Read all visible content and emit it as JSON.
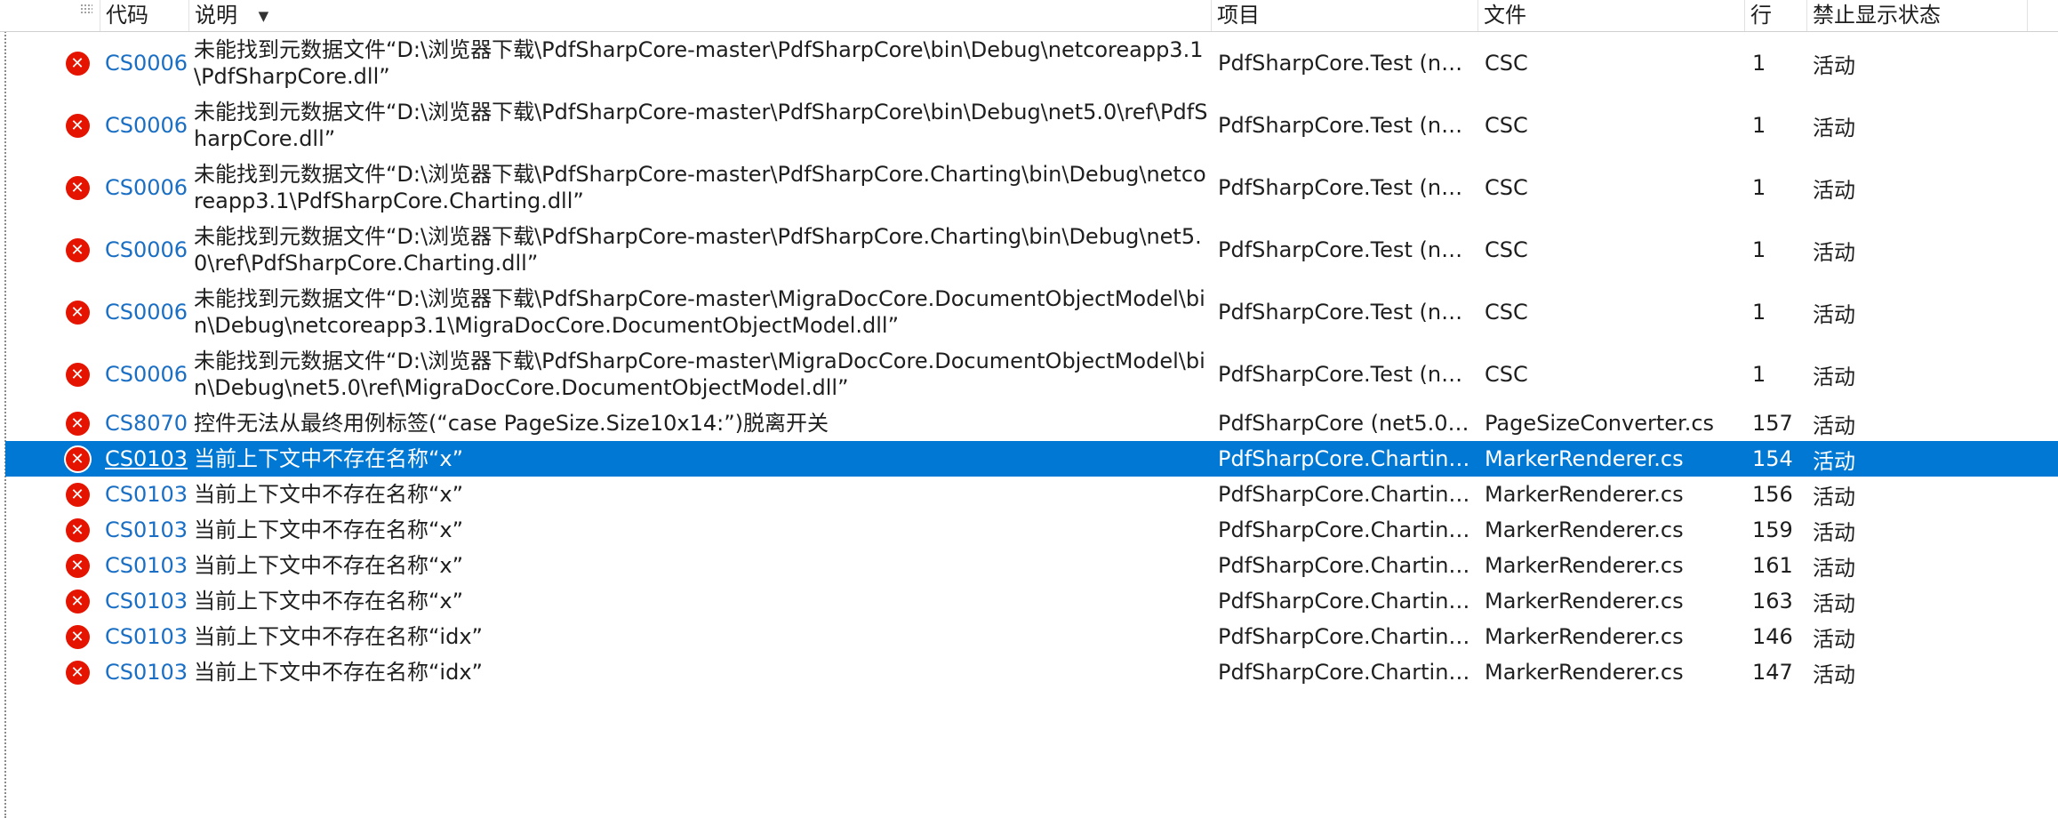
{
  "header": {
    "code": "代码",
    "desc": "说明",
    "project": "项目",
    "file": "文件",
    "line": "行",
    "suppression": "禁止显示状态"
  },
  "rows": [
    {
      "code": "CS0006",
      "desc": "未能找到元数据文件“D:\\浏览器下载\\PdfSharpCore-master\\PdfSharpCore\\bin\\Debug\\netcoreapp3.1\\PdfSharpCore.dll”",
      "project": "PdfSharpCore.Test (net...",
      "file": "CSC",
      "line": "1",
      "state": "活动"
    },
    {
      "code": "CS0006",
      "desc": "未能找到元数据文件“D:\\浏览器下载\\PdfSharpCore-master\\PdfSharpCore\\bin\\Debug\\net5.0\\ref\\PdfSharpCore.dll”",
      "project": "PdfSharpCore.Test (net...",
      "file": "CSC",
      "line": "1",
      "state": "活动"
    },
    {
      "code": "CS0006",
      "desc": "未能找到元数据文件“D:\\浏览器下载\\PdfSharpCore-master\\PdfSharpCore.Charting\\bin\\Debug\\netcoreapp3.1\\PdfSharpCore.Charting.dll”",
      "project": "PdfSharpCore.Test (net...",
      "file": "CSC",
      "line": "1",
      "state": "活动"
    },
    {
      "code": "CS0006",
      "desc": "未能找到元数据文件“D:\\浏览器下载\\PdfSharpCore-master\\PdfSharpCore.Charting\\bin\\Debug\\net5.0\\ref\\PdfSharpCore.Charting.dll”",
      "project": "PdfSharpCore.Test (net...",
      "file": "CSC",
      "line": "1",
      "state": "活动"
    },
    {
      "code": "CS0006",
      "desc": "未能找到元数据文件“D:\\浏览器下载\\PdfSharpCore-master\\MigraDocCore.DocumentObjectModel\\bin\\Debug\\netcoreapp3.1\\MigraDocCore.DocumentObjectModel.dll”",
      "project": "PdfSharpCore.Test (net...",
      "file": "CSC",
      "line": "1",
      "state": "活动"
    },
    {
      "code": "CS0006",
      "desc": "未能找到元数据文件“D:\\浏览器下载\\PdfSharpCore-master\\MigraDocCore.DocumentObjectModel\\bin\\Debug\\net5.0\\ref\\MigraDocCore.DocumentObjectModel.dll”",
      "project": "PdfSharpCore.Test (net...",
      "file": "CSC",
      "line": "1",
      "state": "活动"
    },
    {
      "code": "CS8070",
      "desc": "控件无法从最终用例标签(“case PageSize.Size10x14:”)脱离开关",
      "project": "PdfSharpCore (net5.0),...",
      "file": "PageSizeConverter.cs",
      "line": "157",
      "state": "活动"
    },
    {
      "code": "CS0103",
      "desc": "当前上下文中不存在名称“x”",
      "project": "PdfSharpCore.Charting...",
      "file": "MarkerRenderer.cs",
      "line": "154",
      "state": "活动",
      "selected": true
    },
    {
      "code": "CS0103",
      "desc": "当前上下文中不存在名称“x”",
      "project": "PdfSharpCore.Charting...",
      "file": "MarkerRenderer.cs",
      "line": "156",
      "state": "活动"
    },
    {
      "code": "CS0103",
      "desc": "当前上下文中不存在名称“x”",
      "project": "PdfSharpCore.Charting...",
      "file": "MarkerRenderer.cs",
      "line": "159",
      "state": "活动"
    },
    {
      "code": "CS0103",
      "desc": "当前上下文中不存在名称“x”",
      "project": "PdfSharpCore.Charting...",
      "file": "MarkerRenderer.cs",
      "line": "161",
      "state": "活动"
    },
    {
      "code": "CS0103",
      "desc": "当前上下文中不存在名称“x”",
      "project": "PdfSharpCore.Charting...",
      "file": "MarkerRenderer.cs",
      "line": "163",
      "state": "活动"
    },
    {
      "code": "CS0103",
      "desc": "当前上下文中不存在名称“idx”",
      "project": "PdfSharpCore.Charting...",
      "file": "MarkerRenderer.cs",
      "line": "146",
      "state": "活动"
    },
    {
      "code": "CS0103",
      "desc": "当前上下文中不存在名称“idx”",
      "project": "PdfSharpCore.Charting...",
      "file": "MarkerRenderer.cs",
      "line": "147",
      "state": "活动"
    }
  ],
  "colors": {
    "selection": "#0078d4",
    "error_icon": "#e51400",
    "code_link": "#1a6fc4"
  },
  "icons": {
    "row_icon": "error-icon",
    "sort_indicator": "sort-descending-icon"
  }
}
